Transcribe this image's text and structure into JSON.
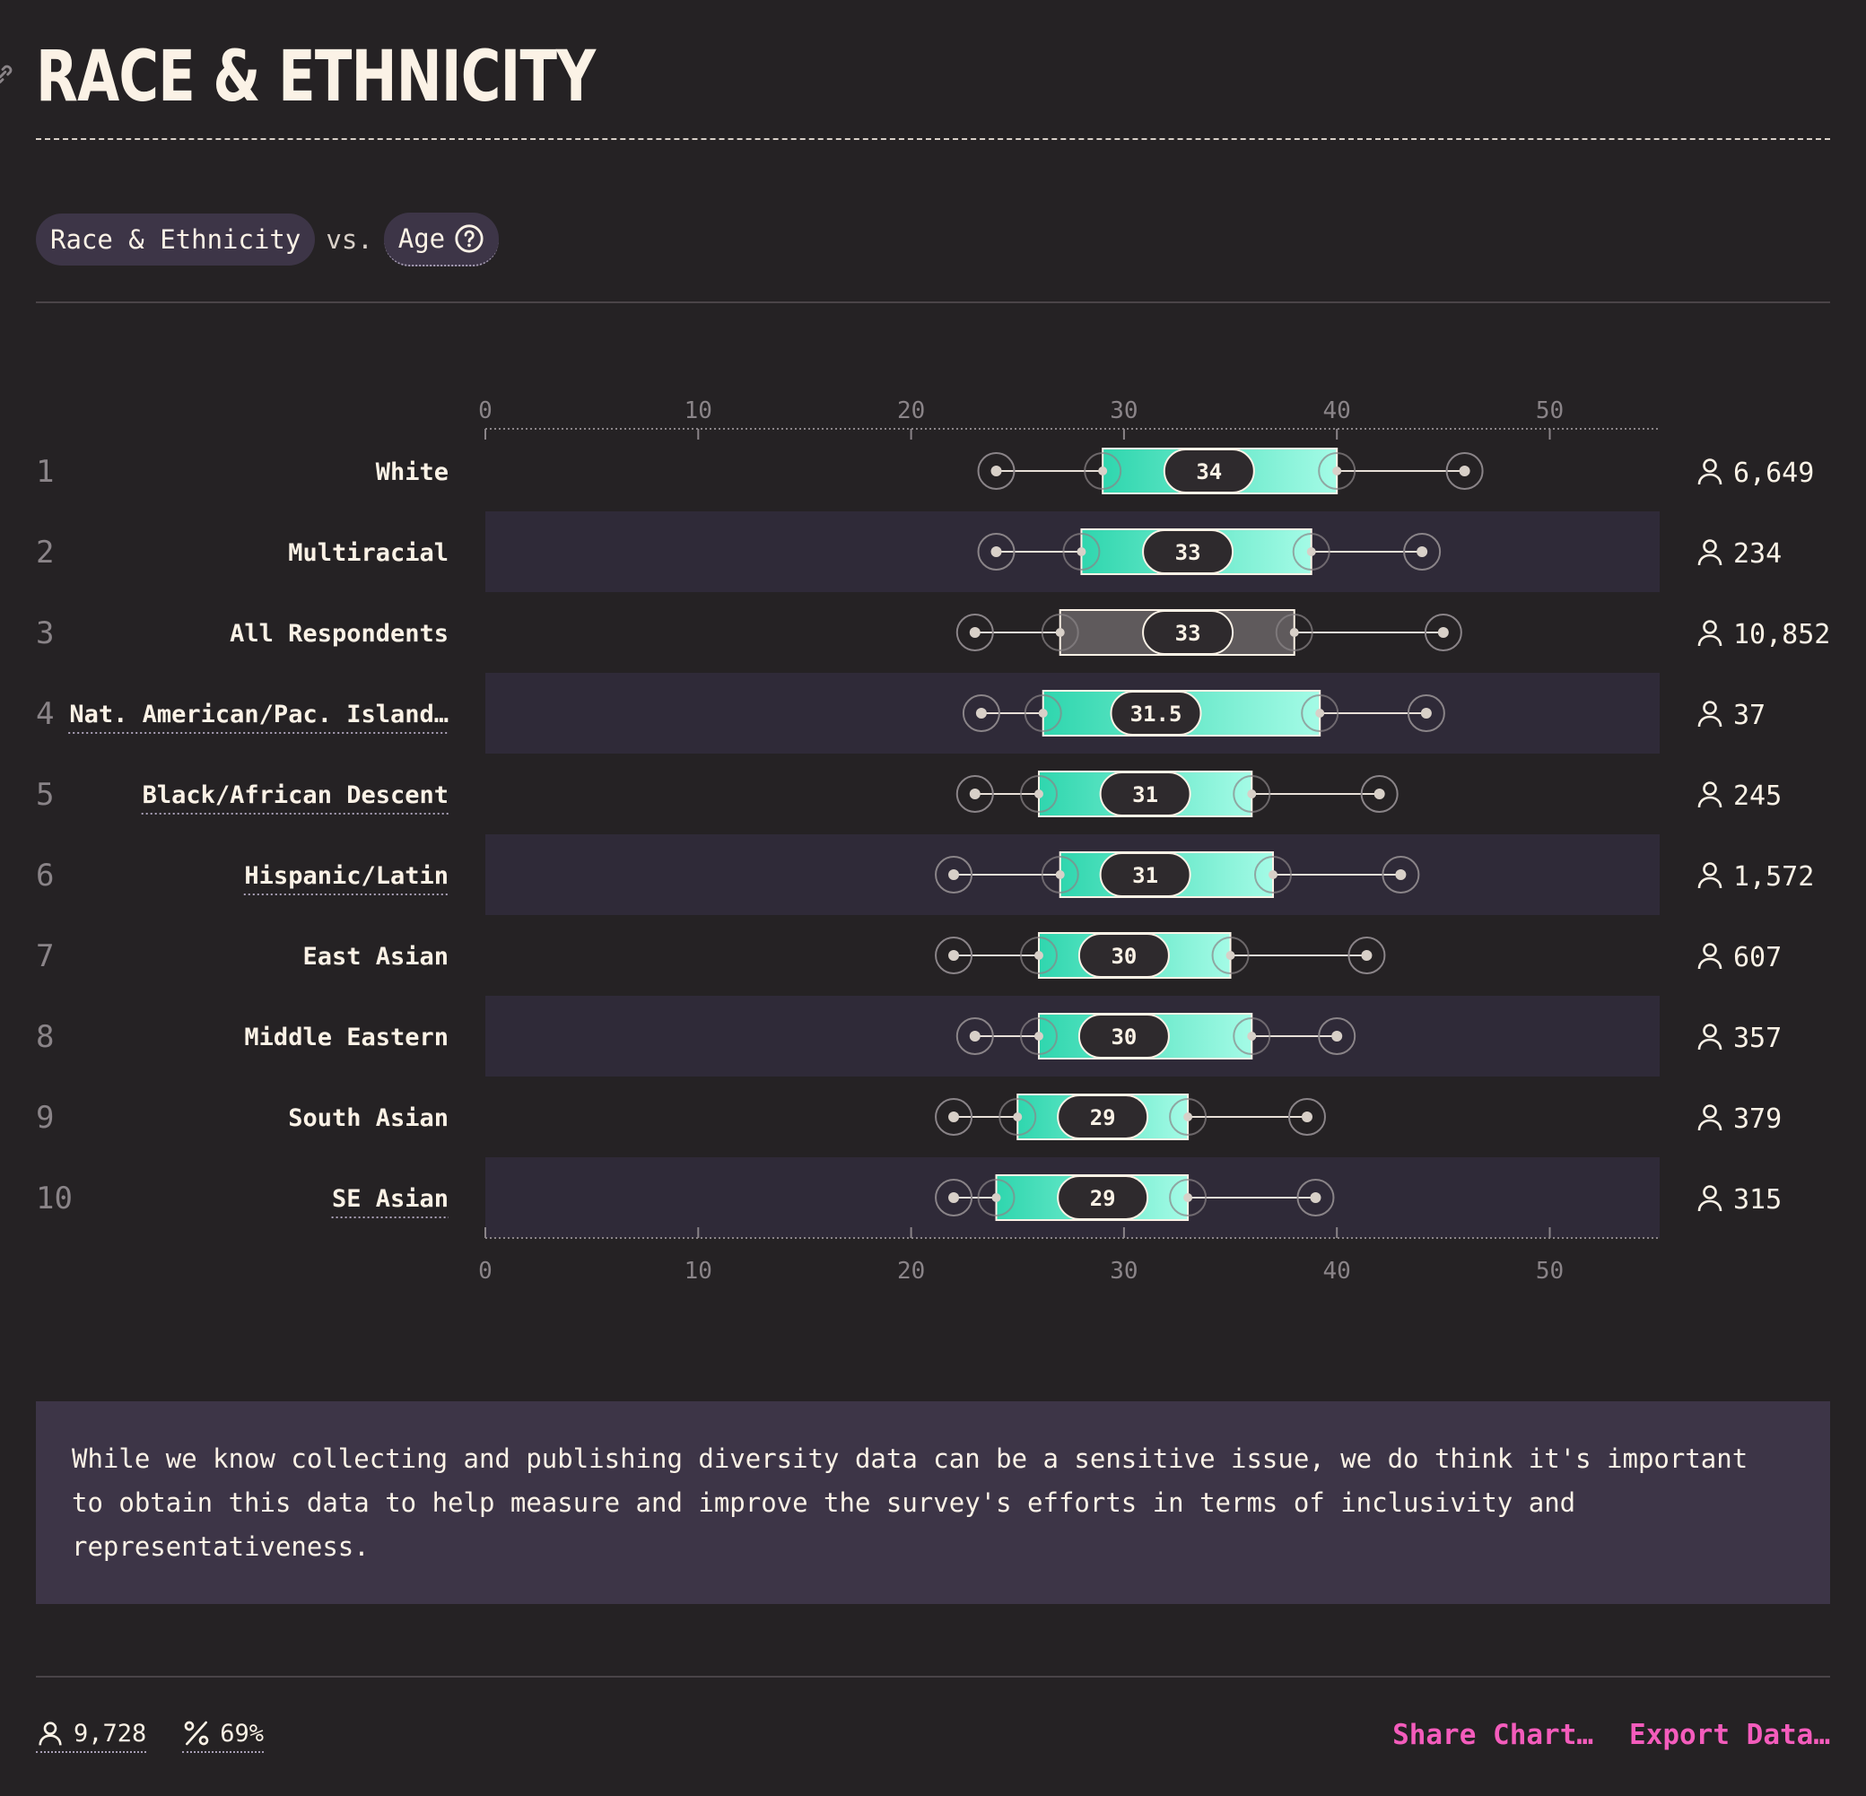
{
  "header": {
    "title": "RACE & ETHNICITY"
  },
  "filters": {
    "primary": "Race & Ethnicity",
    "vs": "vs.",
    "secondary": "Age"
  },
  "chart_data": {
    "type": "boxplot",
    "axis": {
      "ticks": [
        0,
        10,
        20,
        30,
        40,
        50
      ],
      "range": [
        0,
        55
      ]
    },
    "rows": [
      {
        "rank": "1",
        "label": "White",
        "min": 24,
        "q1": 29,
        "median": 34,
        "q3": 40,
        "max": 46,
        "count": "6,649",
        "style": "accent",
        "underlined": false
      },
      {
        "rank": "2",
        "label": "Multiracial",
        "min": 24,
        "q1": 28,
        "median": 33,
        "q3": 38.8,
        "max": 44,
        "count": "234",
        "style": "accent",
        "underlined": false
      },
      {
        "rank": "3",
        "label": "All Respondents",
        "min": 23,
        "q1": 27,
        "median": 33,
        "q3": 38,
        "max": 45,
        "count": "10,852",
        "style": "neutral",
        "underlined": false
      },
      {
        "rank": "4",
        "label": "Nat. American/Pac. Island…",
        "min": 23.3,
        "q1": 26.2,
        "median": 31.5,
        "q3": 39.2,
        "max": 44.2,
        "count": "37",
        "style": "accent",
        "underlined": true
      },
      {
        "rank": "5",
        "label": "Black/African Descent",
        "min": 23,
        "q1": 26,
        "median": 31,
        "q3": 36,
        "max": 42,
        "count": "245",
        "style": "accent",
        "underlined": true
      },
      {
        "rank": "6",
        "label": "Hispanic/Latin",
        "min": 22,
        "q1": 27,
        "median": 31,
        "q3": 37,
        "max": 43,
        "count": "1,572",
        "style": "accent",
        "underlined": true
      },
      {
        "rank": "7",
        "label": "East Asian",
        "min": 22,
        "q1": 26,
        "median": 30,
        "q3": 35,
        "max": 41.4,
        "count": "607",
        "style": "accent",
        "underlined": false
      },
      {
        "rank": "8",
        "label": "Middle Eastern",
        "min": 23,
        "q1": 26,
        "median": 30,
        "q3": 36,
        "max": 40,
        "count": "357",
        "style": "accent",
        "underlined": false
      },
      {
        "rank": "9",
        "label": "South Asian",
        "min": 22,
        "q1": 25,
        "median": 29,
        "q3": 33,
        "max": 38.6,
        "count": "379",
        "style": "accent",
        "underlined": false
      },
      {
        "rank": "10",
        "label": "SE Asian",
        "min": 22,
        "q1": 24,
        "median": 29,
        "q3": 33,
        "max": 39,
        "count": "315",
        "style": "accent",
        "underlined": true
      }
    ],
    "colors": {
      "accent_start": "#2fd6ae",
      "accent_end": "#a4fbe6",
      "neutral_fill": "#5f5a5c",
      "row_band": "#2f2a38",
      "median_pill": "#2e2a2d",
      "whisker": "#e8e0d8",
      "axis": "#8a8488",
      "rank": "#8a8488",
      "text": "#fbf2e6"
    }
  },
  "note": {
    "text": "While we know collecting and publishing diversity data can be a sensitive issue, we do think it's important to obtain this data to help measure and improve the survey's efforts in terms of inclusivity and representativeness."
  },
  "footer": {
    "respondents": "9,728",
    "percent": "69%",
    "share": "Share Chart…",
    "export": "Export Data…"
  },
  "icons": {
    "link": "link-icon",
    "help": "help-icon",
    "person": "person-icon",
    "percent": "percent-icon"
  }
}
